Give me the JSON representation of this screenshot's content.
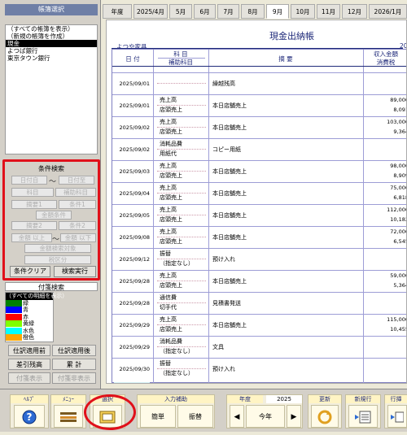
{
  "left": {
    "ledger_header": "帳簿選択",
    "ledgers": [
      "（すべての帳簿を表示）",
      "（新規の帳簿を作成）",
      "現金",
      "よつば銀行",
      "東京タウン銀行"
    ],
    "selected_ledger_index": 2,
    "condition_header": "条件検索",
    "cond_fields": {
      "date_from": "日付自",
      "date_to": "日付至",
      "kamoku": "科目",
      "hojo": "補助科目",
      "tekiyo1": "摘要1",
      "cond1": "条件1",
      "kingaku_joken": "金額条件",
      "tekiyo2": "摘要2",
      "cond2": "条件2",
      "amt_from": "金額 以上",
      "amt_to": "金額 以下",
      "amt_target": "金額検索対象",
      "tax": "税区分"
    },
    "clear_button": "条件クリア",
    "search_button": "検索実行",
    "filter_header": "付箋検索",
    "filters": [
      {
        "label": "（すべての明細を表示）",
        "color": ""
      },
      {
        "label": "緑",
        "color": "#008000"
      },
      {
        "label": "青",
        "color": "#0000ff"
      },
      {
        "label": "赤",
        "color": "#ff0000"
      },
      {
        "label": "黄緑",
        "color": "#7fff00"
      },
      {
        "label": "水色",
        "color": "#00ffff"
      },
      {
        "label": "橙色",
        "color": "#ffa500"
      }
    ],
    "btn_before": "仕訳適用前",
    "btn_after": "仕訳適用後",
    "btn_diff": "差引残高",
    "btn_cumulative": "累 計",
    "btn_fusen_display": "付箋表示",
    "btn_fusen_hide": "付箋非表示"
  },
  "tabs": [
    "年度",
    "2025/4月",
    "5月",
    "6月",
    "7月",
    "8月",
    "9月",
    "10月",
    "11月",
    "12月",
    "2026/1月"
  ],
  "active_tab_index": 6,
  "doc": {
    "title": "現金出納帳",
    "company": "よつや家具",
    "year_fragment": "20",
    "headers": {
      "date": "日 付",
      "kamoku": "科 目",
      "hojo": "補助科目",
      "tekiyo": "摘 要",
      "income": "収入金額",
      "tax": "消費税"
    },
    "rows": [
      {
        "date": "2025/09/01",
        "kamoku": "",
        "hojo": "",
        "tekiyo": "繰越残高",
        "amount": "",
        "tax": ""
      },
      {
        "date": "2025/09/01",
        "kamoku": "売上高",
        "hojo": "店頭売上",
        "tekiyo": "本日店舗売上",
        "amount": "89,000",
        "tax": "8,091"
      },
      {
        "date": "2025/09/02",
        "kamoku": "売上高",
        "hojo": "店頭売上",
        "tekiyo": "本日店舗売上",
        "amount": "103,000",
        "tax": "9,364"
      },
      {
        "date": "2025/09/02",
        "kamoku": "消耗品費",
        "hojo": "用紙代",
        "tekiyo": "コピー用紙",
        "amount": "",
        "tax": ""
      },
      {
        "date": "2025/09/03",
        "kamoku": "売上高",
        "hojo": "店頭売上",
        "tekiyo": "本日店舗売上",
        "amount": "98,000",
        "tax": "8,909"
      },
      {
        "date": "2025/09/04",
        "kamoku": "売上高",
        "hojo": "店頭売上",
        "tekiyo": "本日店舗売上",
        "amount": "75,000",
        "tax": "6,818"
      },
      {
        "date": "2025/09/05",
        "kamoku": "売上高",
        "hojo": "店頭売上",
        "tekiyo": "本日店舗売上",
        "amount": "112,000",
        "tax": "10,182"
      },
      {
        "date": "2025/09/08",
        "kamoku": "売上高",
        "hojo": "店頭売上",
        "tekiyo": "本日店舗売上",
        "amount": "72,000",
        "tax": "6,545"
      },
      {
        "date": "2025/09/12",
        "kamoku": "振替",
        "hojo": "（指定なし）",
        "tekiyo": "預け入れ",
        "amount": "",
        "tax": ""
      },
      {
        "date": "2025/09/28",
        "kamoku": "売上高",
        "hojo": "店頭売上",
        "tekiyo": "本日店舗売上",
        "amount": "59,000",
        "tax": "5,364"
      },
      {
        "date": "2025/09/28",
        "kamoku": "通信費",
        "hojo": "切手代",
        "tekiyo": "見積書発送",
        "amount": "",
        "tax": ""
      },
      {
        "date": "2025/09/29",
        "kamoku": "売上高",
        "hojo": "店頭売上",
        "tekiyo": "本日店舗売上",
        "amount": "115,000",
        "tax": "10,455"
      },
      {
        "date": "2025/09/29",
        "kamoku": "消耗品費",
        "hojo": "（指定なし）",
        "tekiyo": "文具",
        "amount": "",
        "tax": ""
      },
      {
        "date": "2025/09/30",
        "kamoku": "振替",
        "hojo": "（指定なし）",
        "tekiyo": "預け入れ",
        "amount": "",
        "tax": ""
      }
    ]
  },
  "toolbar": {
    "help_label": "ﾍﾙﾌﾟ",
    "menu_label": "ﾒﾆｭｰ",
    "select_label": "選択",
    "input_assist_label": "入力補助",
    "kanan_label": "簡単",
    "furikae_label": "振替",
    "year_label": "年度",
    "year_value": "2025",
    "today_label": "今年",
    "update_label": "更新",
    "newrow_label": "新規行",
    "row_label": "行挿"
  }
}
